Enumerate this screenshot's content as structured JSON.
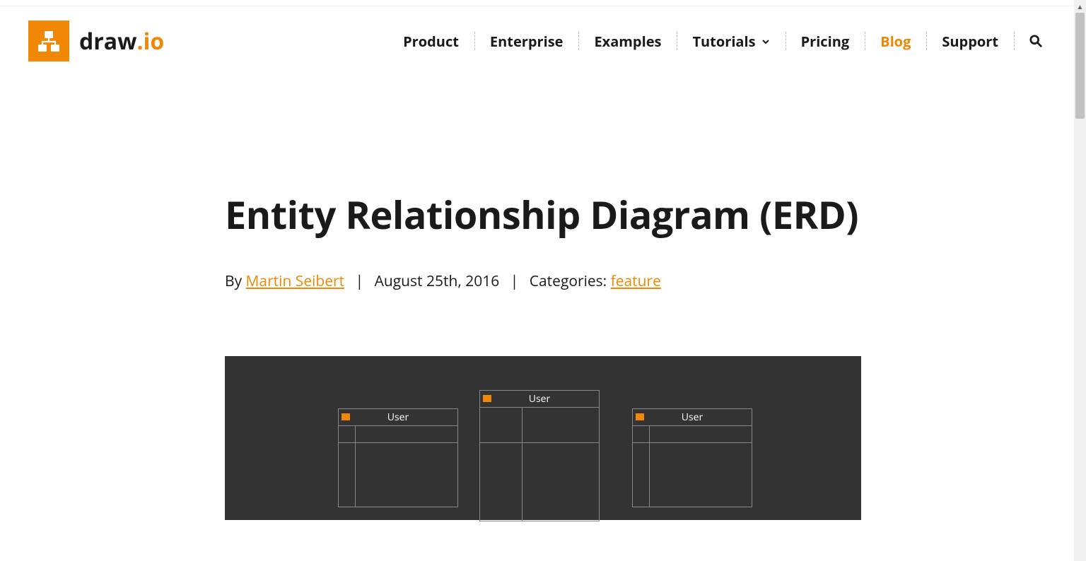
{
  "brand": {
    "name": "draw",
    "suffix": ".io"
  },
  "nav": {
    "items": [
      {
        "label": "Product",
        "active": false,
        "hasChevron": false
      },
      {
        "label": "Enterprise",
        "active": false,
        "hasChevron": false
      },
      {
        "label": "Examples",
        "active": false,
        "hasChevron": false
      },
      {
        "label": "Tutorials",
        "active": false,
        "hasChevron": true
      },
      {
        "label": "Pricing",
        "active": false,
        "hasChevron": false
      },
      {
        "label": "Blog",
        "active": true,
        "hasChevron": false
      },
      {
        "label": "Support",
        "active": false,
        "hasChevron": false
      }
    ]
  },
  "post": {
    "title": "Entity Relationship Diagram (ERD)",
    "by_prefix": "By ",
    "author": "Martin Seibert",
    "date": "August 25th, 2016",
    "categories_label": "Categories: ",
    "category": "feature"
  },
  "diagram": {
    "entities": [
      {
        "title": "User"
      },
      {
        "title": "User"
      },
      {
        "title": "User"
      }
    ]
  }
}
